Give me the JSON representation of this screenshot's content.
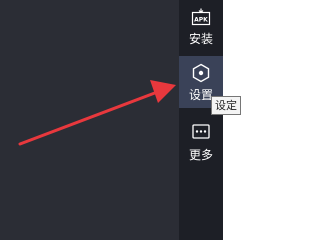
{
  "sidebar": {
    "items": [
      {
        "label": "安装",
        "icon": "apk-install-icon",
        "active": false
      },
      {
        "label": "设置",
        "icon": "settings-icon",
        "active": true
      },
      {
        "label": "更多",
        "icon": "more-icon",
        "active": false
      }
    ]
  },
  "tooltip": {
    "text": "设定"
  },
  "annotation": {
    "icon": "red-arrow-icon",
    "color": "#e8383d"
  },
  "colors": {
    "background": "#2b2d35",
    "sidebar": "#1d1f26",
    "active_item": "#3a4258"
  }
}
